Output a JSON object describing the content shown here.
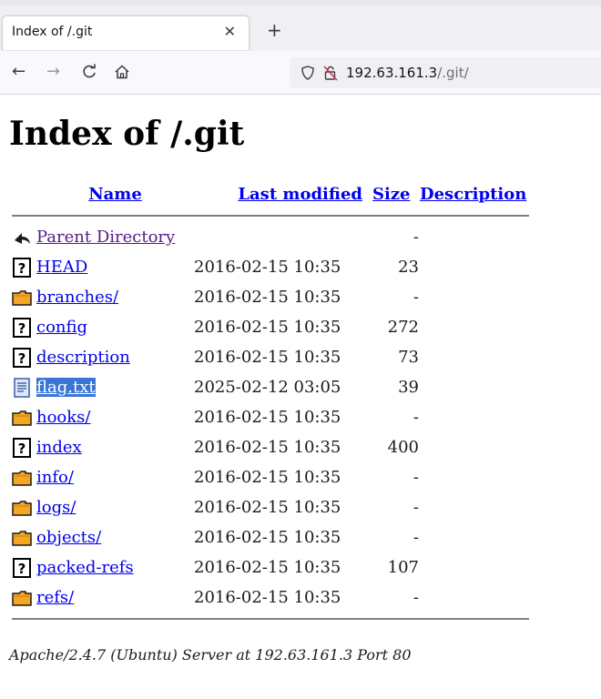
{
  "browser": {
    "tab_title": "Index of /.git",
    "url_host": "192.63.161.3",
    "url_path": "/.git/",
    "icons": {
      "close": "close-icon",
      "new_tab": "plus-icon",
      "back": "arrow-left-icon",
      "forward": "arrow-right-icon",
      "reload": "reload-icon",
      "home": "home-icon",
      "shield": "shield-icon",
      "lock": "insecure-lock-icon"
    }
  },
  "page": {
    "title": "Index of /.git",
    "columns": {
      "name": "Name",
      "last_modified": "Last modified",
      "size": "Size",
      "description": "Description"
    },
    "parent": {
      "label": "Parent Directory",
      "size": "-",
      "icon": "back-arrow-icon"
    },
    "rows": [
      {
        "name": "HEAD",
        "date": "2016-02-15 10:35",
        "size": "23",
        "icon": "unknown-file-icon"
      },
      {
        "name": "branches/",
        "date": "2016-02-15 10:35",
        "size": "-",
        "icon": "folder-icon"
      },
      {
        "name": "config",
        "date": "2016-02-15 10:35",
        "size": "272",
        "icon": "unknown-file-icon"
      },
      {
        "name": "description",
        "date": "2016-02-15 10:35",
        "size": "73",
        "icon": "unknown-file-icon"
      },
      {
        "name": "flag.txt",
        "date": "2025-02-12 03:05",
        "size": "39",
        "icon": "text-file-icon",
        "selected": true
      },
      {
        "name": "hooks/",
        "date": "2016-02-15 10:35",
        "size": "-",
        "icon": "folder-icon"
      },
      {
        "name": "index",
        "date": "2016-02-15 10:35",
        "size": "400",
        "icon": "unknown-file-icon"
      },
      {
        "name": "info/",
        "date": "2016-02-15 10:35",
        "size": "-",
        "icon": "folder-icon"
      },
      {
        "name": "logs/",
        "date": "2016-02-15 10:35",
        "size": "-",
        "icon": "folder-icon"
      },
      {
        "name": "objects/",
        "date": "2016-02-15 10:35",
        "size": "-",
        "icon": "folder-icon"
      },
      {
        "name": "packed-refs",
        "date": "2016-02-15 10:35",
        "size": "107",
        "icon": "unknown-file-icon"
      },
      {
        "name": "refs/",
        "date": "2016-02-15 10:35",
        "size": "-",
        "icon": "folder-icon"
      }
    ],
    "footer": "Apache/2.4.7 (Ubuntu) Server at 192.63.161.3 Port 80"
  },
  "colors": {
    "link": "#0000ee",
    "visited": "#551a8b",
    "selection": "#3875d7",
    "rule": "#808080"
  }
}
